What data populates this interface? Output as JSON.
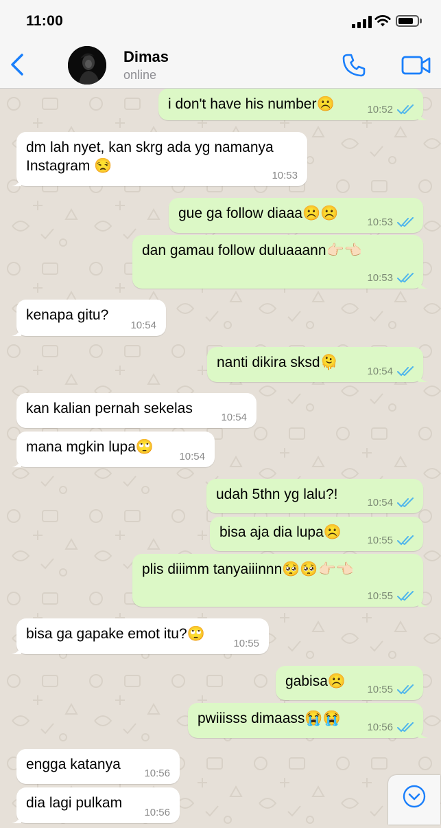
{
  "status_bar": {
    "time": "11:00"
  },
  "header": {
    "contact_name": "Dimas",
    "contact_status": "online",
    "accent_color": "#1a7ffb"
  },
  "theme": {
    "incoming_bubble_color": "#ffffff",
    "outgoing_bubble_color": "#dcf8c6",
    "read_tick_color": "#4fb5ec"
  },
  "messages": [
    {
      "direction": "out",
      "text": "i don't have his number☹️",
      "time": "10:52",
      "status": "read"
    },
    {
      "direction": "in",
      "text": "dm lah nyet, kan skrg ada yg namanya Instagram 😒",
      "time": "10:53"
    },
    {
      "direction": "out",
      "text": "gue ga follow diaaa☹️☹️",
      "time": "10:53",
      "status": "read"
    },
    {
      "direction": "out",
      "text": "dan gamau follow duluaaann👉🏻👈🏻",
      "time": "10:53",
      "status": "read"
    },
    {
      "direction": "in",
      "text": "kenapa gitu?",
      "time": "10:54"
    },
    {
      "direction": "out",
      "text": "nanti dikira sksd🫠",
      "time": "10:54",
      "status": "read"
    },
    {
      "direction": "in",
      "text": "kan kalian pernah sekelas",
      "time": "10:54"
    },
    {
      "direction": "in",
      "text": "mana mgkin lupa🙄",
      "time": "10:54"
    },
    {
      "direction": "out",
      "text": "udah 5thn yg lalu?!",
      "time": "10:54",
      "status": "read"
    },
    {
      "direction": "out",
      "text": "bisa aja dia lupa☹️",
      "time": "10:55",
      "status": "read"
    },
    {
      "direction": "out",
      "text": "plis diiimm tanyaiiinnn🥺🥺👉🏻👈🏻",
      "time": "10:55",
      "status": "read"
    },
    {
      "direction": "in",
      "text": "bisa ga gapake emot itu?🙄",
      "time": "10:55"
    },
    {
      "direction": "out",
      "text": "gabisa☹️",
      "time": "10:55",
      "status": "read"
    },
    {
      "direction": "out",
      "text": "pwiiisss dimaass😭😭",
      "time": "10:56",
      "status": "read"
    },
    {
      "direction": "in",
      "text": "engga katanya",
      "time": "10:56"
    },
    {
      "direction": "in",
      "text": "dia lagi pulkam",
      "time": "10:56"
    }
  ]
}
